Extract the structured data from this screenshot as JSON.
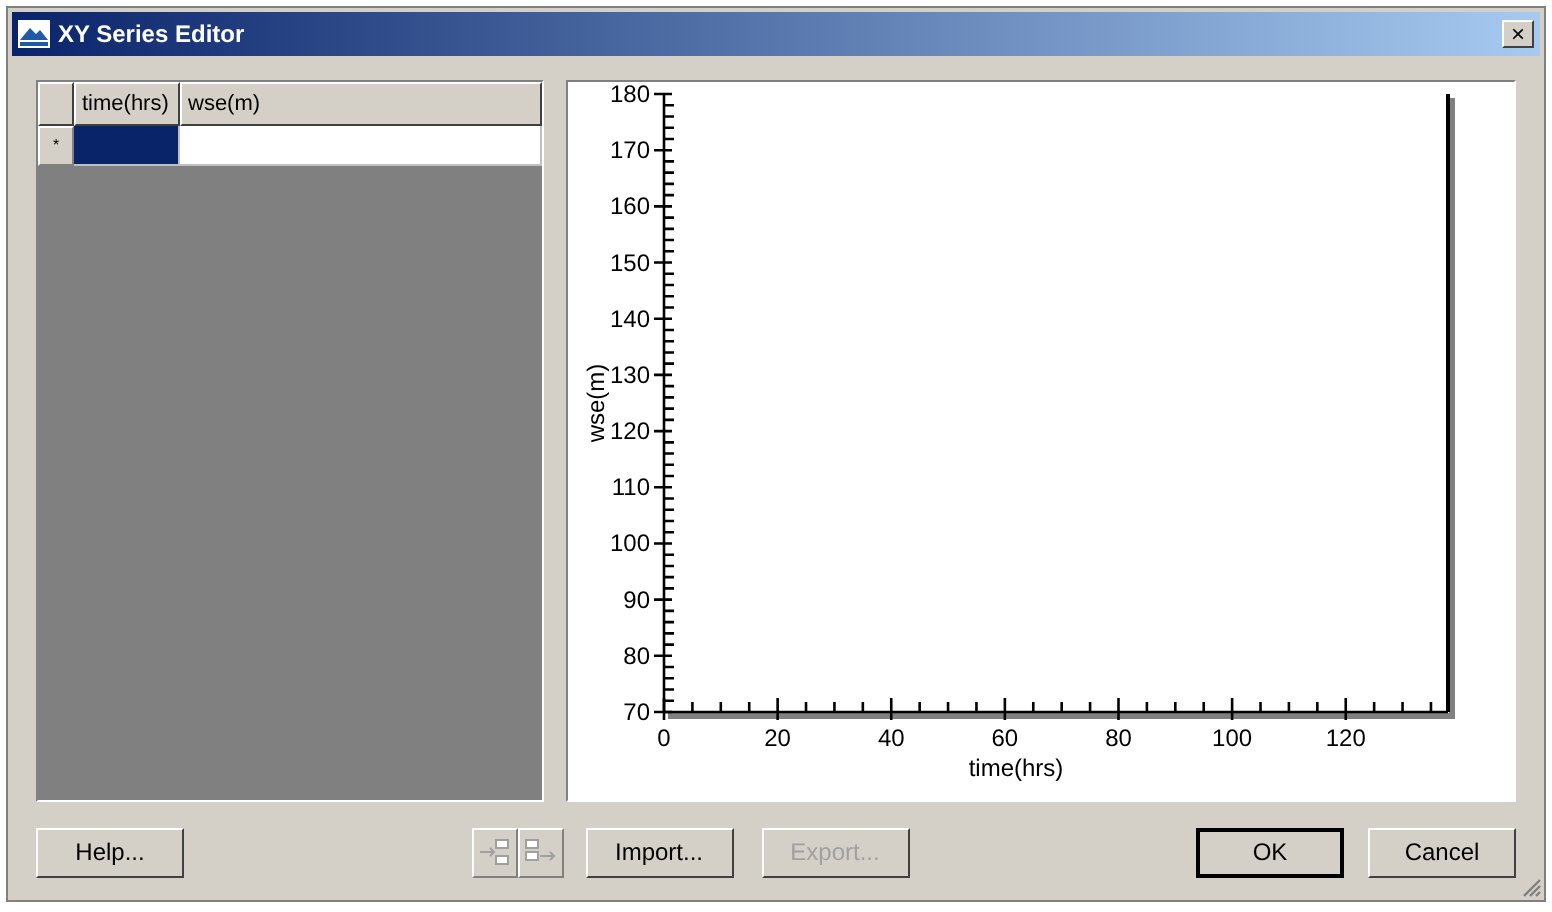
{
  "window": {
    "title": "XY Series Editor",
    "close_label": "×"
  },
  "table": {
    "columns": [
      "time(hrs)",
      "wse(m)"
    ],
    "new_row_marker": "*",
    "rows": [
      {
        "selected": true,
        "cells": [
          "",
          ""
        ]
      }
    ]
  },
  "chart_data": {
    "type": "line",
    "xlabel": "time(hrs)",
    "ylabel": "wse(m)",
    "xlim": [
      0,
      138
    ],
    "ylim": [
      70,
      180
    ],
    "xticks": [
      0,
      20,
      40,
      60,
      80,
      100,
      120
    ],
    "yticks": [
      70,
      80,
      90,
      100,
      110,
      120,
      130,
      140,
      150,
      160,
      170,
      180
    ]
  },
  "buttons": [
    {
      "label": "Help...",
      "disabled": false,
      "default": false
    },
    {
      "label": "Import...",
      "disabled": false,
      "default": false
    },
    {
      "label": "Export...",
      "disabled": true,
      "default": false
    },
    {
      "label": "OK",
      "disabled": false,
      "default": true
    },
    {
      "label": "Cancel",
      "disabled": false,
      "default": false
    }
  ],
  "toolbar": [
    {
      "kind": "insert",
      "disabled": true
    },
    {
      "kind": "append",
      "disabled": true
    }
  ]
}
